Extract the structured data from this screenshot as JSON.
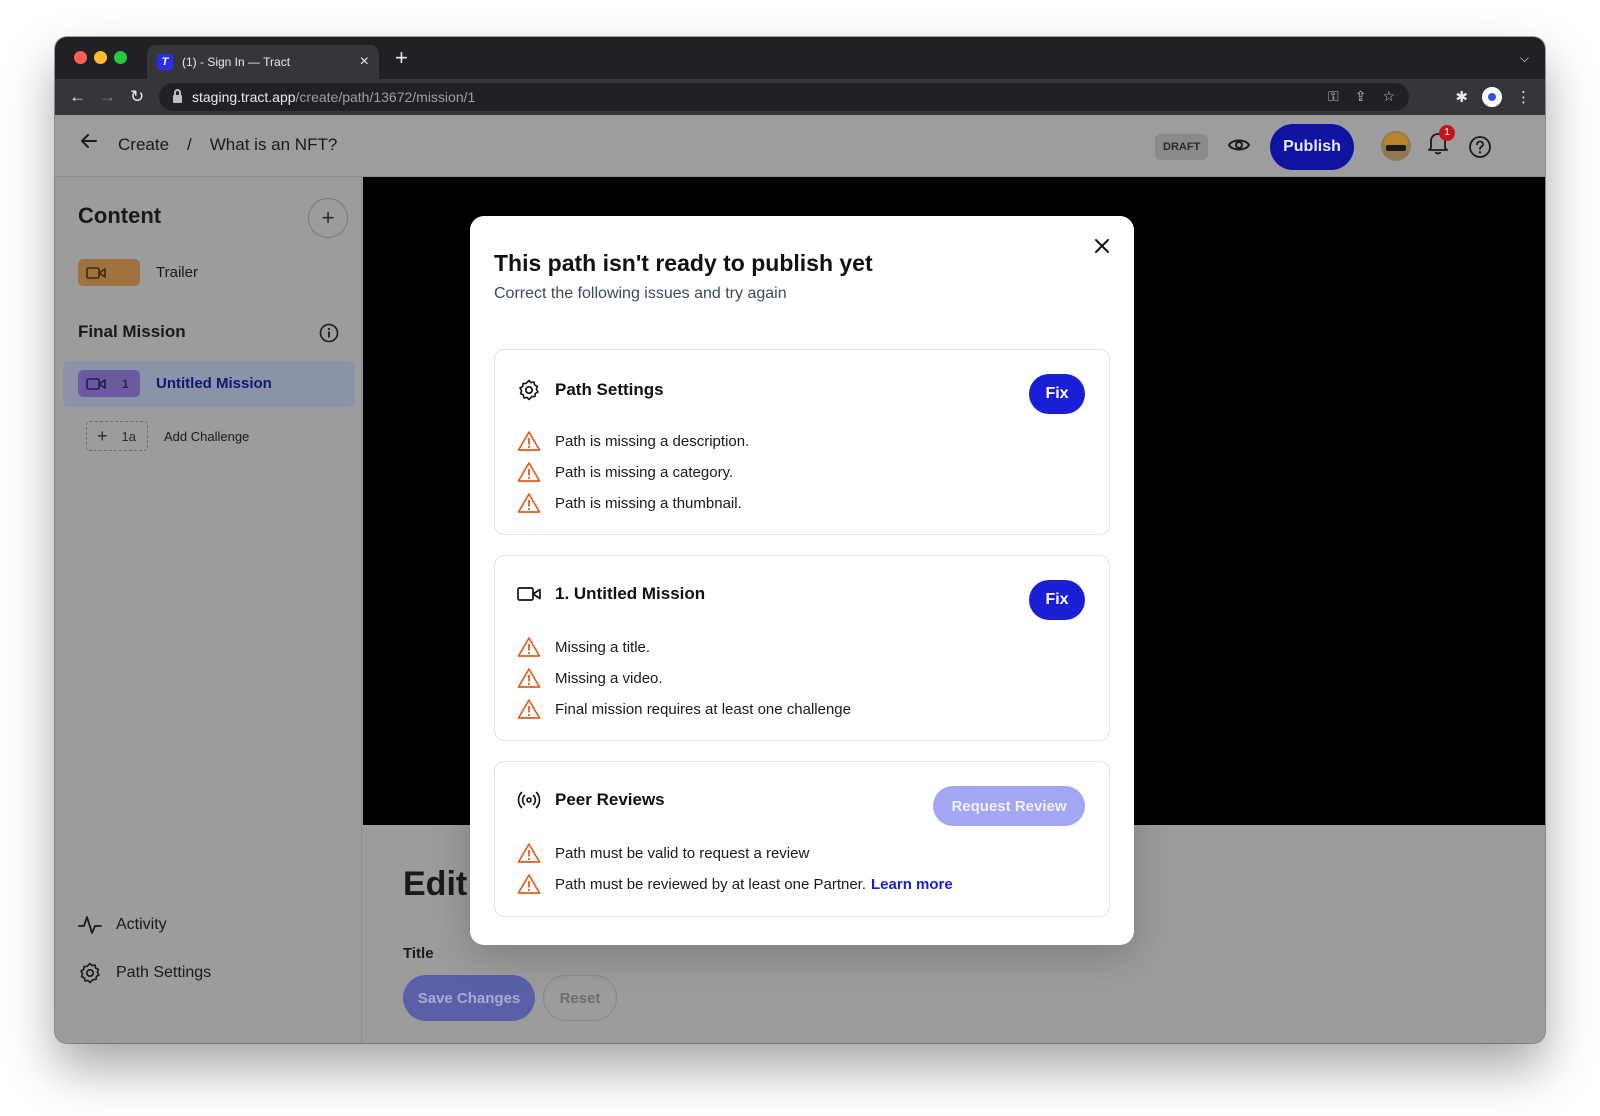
{
  "browser": {
    "tab_title": "(1) - Sign In — Tract",
    "tab_favicon": "T",
    "url_host": "staging.tract.app",
    "url_path": "/create/path/13672/mission/1"
  },
  "header": {
    "breadcrumb_root": "Create",
    "breadcrumb_sep": "/",
    "breadcrumb_current": "What is an NFT?",
    "draft_badge": "DRAFT",
    "publish_label": "Publish",
    "notification_count": "1"
  },
  "sidebar": {
    "title": "Content",
    "trailer_label": "Trailer",
    "section_title": "Final Mission",
    "mission_number": "1",
    "mission_label": "Untitled Mission",
    "challenge_number": "1a",
    "add_challenge_label": "Add Challenge",
    "activity_label": "Activity",
    "path_settings_label": "Path Settings"
  },
  "main": {
    "edit_heading": "Edit",
    "title_label": "Title",
    "save_label": "Save Changes",
    "reset_label": "Reset"
  },
  "modal": {
    "title": "This path isn't ready to publish yet",
    "subtitle": "Correct the following issues and try again",
    "cards": [
      {
        "title": "Path Settings",
        "action": "Fix",
        "icon": "gear-icon",
        "issues": [
          "Path is missing a description.",
          "Path is missing a category.",
          "Path is missing a thumbnail."
        ]
      },
      {
        "title": "1. Untitled Mission",
        "action": "Fix",
        "icon": "video-camera-icon",
        "issues": [
          "Missing a title.",
          "Missing a video.",
          "Final mission requires at least one challenge"
        ]
      },
      {
        "title": "Peer Reviews",
        "action": "Request Review",
        "icon": "broadcast-icon",
        "issues": [
          "Path must be valid to request a review",
          "Path must be reviewed by at least one Partner."
        ],
        "link": "Learn more"
      }
    ]
  },
  "colors": {
    "accent": "#1a1fd6",
    "warning": "#e35d1f",
    "publish": "#0e14a0"
  }
}
